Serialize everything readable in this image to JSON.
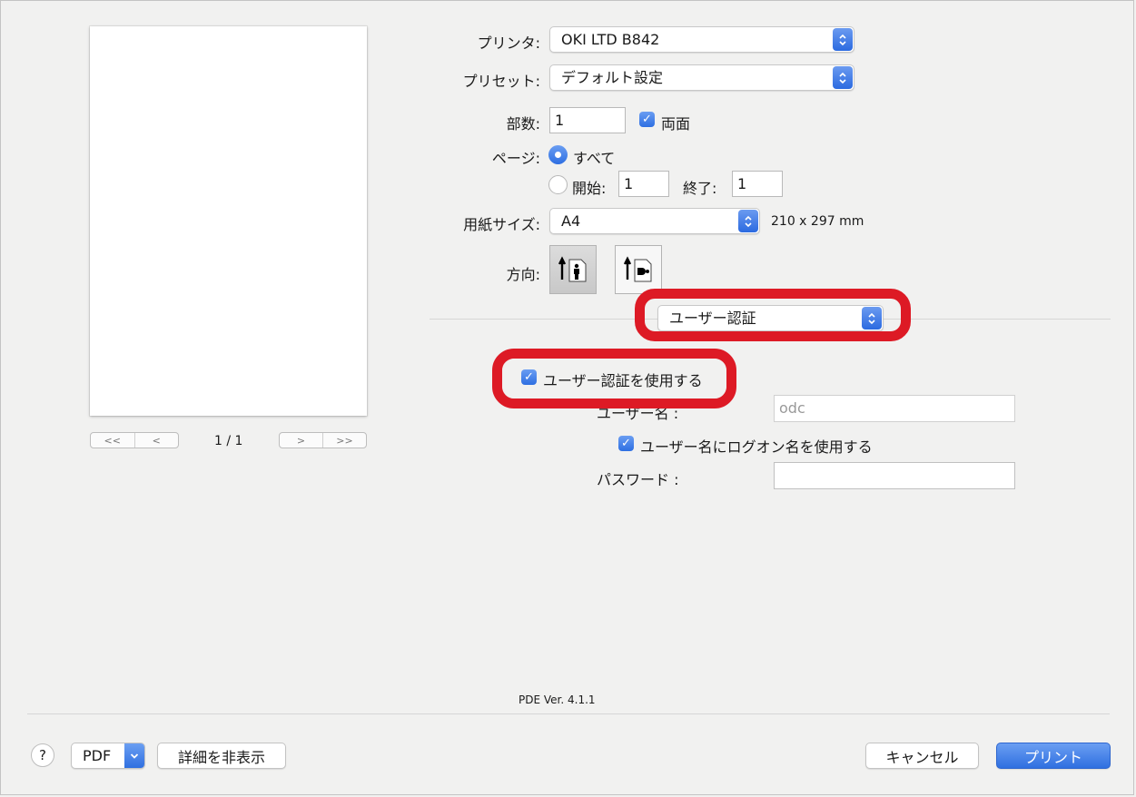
{
  "preview": {
    "page_counter": "1 / 1"
  },
  "nav": {
    "first": "<<",
    "prev": "<",
    "next": ">",
    "last": ">>"
  },
  "printer": {
    "label": "プリンタ:",
    "value": "OKI LTD B842"
  },
  "preset": {
    "label": "プリセット:",
    "value": "デフォルト設定"
  },
  "copies": {
    "label": "部数:",
    "value": "1",
    "duplex_label": "両面",
    "duplex_checked": true
  },
  "pages": {
    "label": "ページ:",
    "all_label": "すべて",
    "from_label": "開始:",
    "from_value": "1",
    "to_label": "終了:",
    "to_value": "1"
  },
  "paper": {
    "label": "用紙サイズ:",
    "value": "A4",
    "dimensions": "210 x 297 mm"
  },
  "orientation": {
    "label": "方向:"
  },
  "panel_selector": {
    "value": "ユーザー認証"
  },
  "auth": {
    "use_auth_label": "ユーザー認証を使用する",
    "username_label": "ユーザー名 :",
    "username_value": "odc",
    "use_logon_label": "ユーザー名にログオン名を使用する",
    "password_label": "パスワード :",
    "password_value": ""
  },
  "version": "PDE Ver. 4.1.1",
  "footer": {
    "help": "?",
    "pdf": "PDF",
    "hide_details": "詳細を非表示",
    "cancel": "キャンセル",
    "print": "プリント"
  },
  "colors": {
    "accent": "#2f6fe0",
    "highlight": "#dd1a25"
  }
}
